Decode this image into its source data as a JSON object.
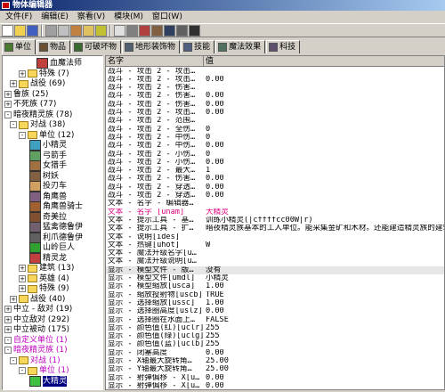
{
  "title": "物体编辑器",
  "menu": [
    "文件(F)",
    "编辑(E)",
    "察看(V)",
    "模块(M)",
    "窗口(W)"
  ],
  "tabs": [
    {
      "label": "单位",
      "active": true,
      "color": "#4a7a30"
    },
    {
      "label": "物品",
      "color": "#6a5030"
    },
    {
      "label": "可破坏物",
      "color": "#3a6a30"
    },
    {
      "label": "地形装饰物",
      "color": "#506070"
    },
    {
      "label": "技能",
      "color": "#506080"
    },
    {
      "label": "魔法效果",
      "color": "#507060"
    },
    {
      "label": "科技",
      "color": "#605070"
    }
  ],
  "tree": [
    {
      "label": "血魔法师",
      "icon": "unit-icon"
    },
    {
      "label": "特殊 (7)",
      "icon": "folder-icon",
      "exp": "+"
    },
    {
      "label": "战役 (69)",
      "icon": "folder-icon",
      "exp": "+"
    },
    {
      "label": "鲁族 (25)",
      "exp": "+"
    },
    {
      "label": "不死族 (77)",
      "exp": "+"
    },
    {
      "label": "暗夜精灵族 (78)",
      "exp": "-"
    },
    {
      "label": "对战 (38)",
      "icon": "folder-icon",
      "exp": "-"
    },
    {
      "label": "单位 (12)",
      "icon": "folder-icon",
      "exp": "-"
    },
    {
      "label": "小精灵",
      "icon": "unit-icon"
    },
    {
      "label": "弓箭手",
      "icon": "unit-icon"
    },
    {
      "label": "女猎手",
      "icon": "unit-icon"
    },
    {
      "label": "树妖",
      "icon": "unit-icon"
    },
    {
      "label": "投刃车",
      "icon": "unit-icon"
    },
    {
      "label": "角鹰兽",
      "icon": "unit-icon"
    },
    {
      "label": "角鹰兽骑士",
      "icon": "unit-icon"
    },
    {
      "label": "奇美拉",
      "icon": "unit-icon"
    },
    {
      "label": "猛禽德鲁伊",
      "icon": "unit-icon"
    },
    {
      "label": "利爪德鲁伊",
      "icon": "unit-icon"
    },
    {
      "label": "山岭巨人",
      "icon": "unit-icon"
    },
    {
      "label": "精灵龙",
      "icon": "unit-icon"
    },
    {
      "label": "建筑 (13)",
      "icon": "folder-icon",
      "exp": "+"
    },
    {
      "label": "英雄 (4)",
      "icon": "folder-icon",
      "exp": "+"
    },
    {
      "label": "特殊 (9)",
      "icon": "folder-icon",
      "exp": "+"
    },
    {
      "label": "战役 (40)",
      "icon": "folder-icon",
      "exp": "+"
    },
    {
      "label": "中立 - 敌对 (19)",
      "exp": "+"
    },
    {
      "label": "中立敌对 (292)",
      "exp": "+"
    },
    {
      "label": "中立被动 (175)",
      "exp": "+"
    },
    {
      "label": "自定义单位 (1)",
      "exp": "-",
      "pink": true
    },
    {
      "label": "暗夜精灵族 (1)",
      "exp": "-",
      "pink": true
    },
    {
      "label": "对战 (1)",
      "icon": "folder-icon",
      "exp": "-",
      "pink": true
    },
    {
      "label": "单位 (1)",
      "icon": "folder-icon",
      "exp": "-",
      "pink": true
    },
    {
      "label": "大精灵",
      "icon": "unit-icon",
      "selected": true
    }
  ],
  "grid_headers": [
    "名字",
    "值"
  ],
  "rows": [
    [
      "战斗 - 攻击 2 - 攻击…",
      ""
    ],
    [
      "战斗 - 攻击 2 - 攻击…",
      "0.00"
    ],
    [
      "战斗 - 攻击 2 - 伤害…",
      ""
    ],
    [
      "战斗 - 攻击 2 - 伤害…",
      "0.00"
    ],
    [
      "战斗 - 攻击 2 - 伤害…",
      "0.00"
    ],
    [
      "战斗 - 攻击 2 - 攻击…",
      "0.00"
    ],
    [
      "战斗 - 攻击 2 - 范围…",
      ""
    ],
    [
      "战斗 - 攻击 2 - 全伤…",
      "0"
    ],
    [
      "战斗 - 攻击 2 - 中伤…",
      "0"
    ],
    [
      "战斗 - 攻击 2 - 中伤…",
      "0.00"
    ],
    [
      "战斗 - 攻击 2 - 小伤…",
      "0"
    ],
    [
      "战斗 - 攻击 2 - 小伤…",
      "0.00"
    ],
    [
      "战斗 - 攻击 2 - 最大…",
      "1"
    ],
    [
      "战斗 - 攻击 2 - 伤害…",
      "0.00"
    ],
    [
      "战斗 - 攻击 2 - 穿透…",
      "0.00"
    ],
    [
      "战斗 - 攻击 2 - 穿透…",
      "0.00"
    ],
    [
      "文本 - 名字 - 编辑器…",
      ""
    ],
    [
      "文本 - 名字 [unam]",
      "大精灵",
      "red"
    ],
    [
      "文本 - 提示工具 - 基…",
      "训练小精灵(|cffffcc00W|r)"
    ],
    [
      "文本 - 提示工具 - 扩…",
      "暗夜精灵族基本的工人单位。能采集金矿和木材。还能建造精灵族的建筑"
    ],
    [
      "文本 - 说明[ides]",
      ""
    ],
    [
      "文本 - 热键[uhot]",
      "W"
    ],
    [
      "文本 - 魔法升级名字[u…",
      ""
    ],
    [
      "文本 - 魔法升级说明[u…",
      ""
    ],
    [
      "显示 - 模型文件 - 版…",
      "没有",
      "hl"
    ],
    [
      "显示 - 模型文件[umdl]",
      "小精灵"
    ],
    [
      "显示 - 模型缩放[usca]",
      "1.00"
    ],
    [
      "显示 - 缩放投射物[uscb]",
      "TRUE"
    ],
    [
      "显示 - 选择缩放[ussc]",
      "1.00"
    ],
    [
      "显示 - 选择圈高度[uslz]",
      "0.00"
    ],
    [
      "显示 - 选择圈在水面上…",
      "FALSE"
    ],
    [
      "显示 - 颜色值(红)[uclr]",
      "255"
    ],
    [
      "显示 - 颜色值(绿)[uclg]",
      "255"
    ],
    [
      "显示 - 颜色值(蓝)[uclb]",
      "255"
    ],
    [
      "显示 - 闭塞高度",
      "0.00"
    ],
    [
      "显示 - X轴最大旋转角…",
      "25.00"
    ],
    [
      "显示 - Y轴最大旋转角…",
      "25.00"
    ],
    [
      "显示 - 射弹偏移 - X[u…",
      "0.00"
    ],
    [
      "显示 - 射弹偏移 - X[u…",
      "0.00"
    ]
  ]
}
